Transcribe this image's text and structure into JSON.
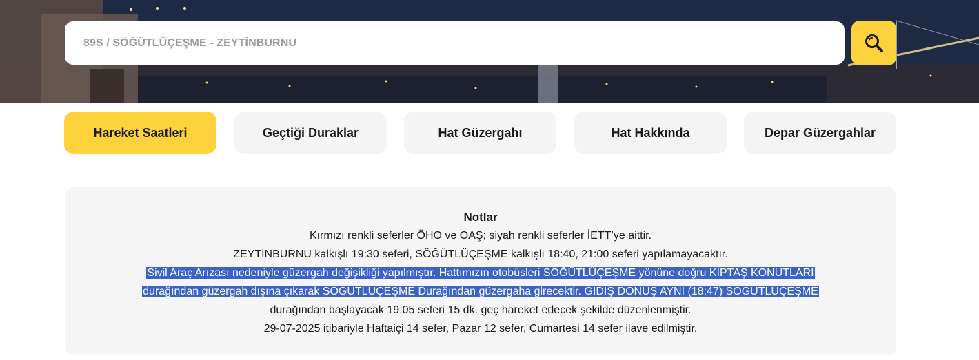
{
  "search": {
    "value": "",
    "placeholder": "89S / SÖĞÜTLÜÇEŞME - ZEYTİNBURNU",
    "button_icon": "search-icon"
  },
  "tabs": [
    {
      "label": "Hareket Saatleri",
      "active": true
    },
    {
      "label": "Geçtiği Duraklar",
      "active": false
    },
    {
      "label": "Hat Güzergahı",
      "active": false
    },
    {
      "label": "Hat Hakkında",
      "active": false
    },
    {
      "label": "Depar Güzergahlar",
      "active": false
    }
  ],
  "notes": {
    "title": "Notlar",
    "line1": "Kırmızı renkli seferler ÖHO ve OAŞ; siyah renkli seferler İETT’ye aittir.",
    "line2": "ZEYTİNBURNU kalkışlı 19:30 seferi, SÖĞÜTLÜÇEŞME kalkışlı 18:40, 21:00 seferi yapılamayacaktır.",
    "highlight_line1": "Sivil Araç Arızası nedeniyle güzergah değişikliği yapılmıştır. Hattımızın otobüsleri SÖĞÜTLÜÇEŞME yönüne doğru KİPTAŞ KONUTLARI",
    "highlight_line2": "durağından güzergah dışına çıkarak SÖĞÜTLÜÇEŞME Durağından güzergaha girecektir. GİDİŞ DÖNÜŞ AYNI (18:47) SÖĞÜTLÜÇEŞME",
    "line3": "durağından başlayacak 19:05 seferi 15 dk. geç hareket edecek şekilde düzenlenmiştir.",
    "line4": "29-07-2025 itibariyle Haftaiçi 14 sefer, Pazar 12 sefer, Cumartesi 14 sefer ilave edilmiştir."
  },
  "colors": {
    "accent": "#fdd23c",
    "tab_inactive": "#f4f4f4",
    "notes_bg": "#f5f5f5",
    "selection": "#3b63c4"
  }
}
